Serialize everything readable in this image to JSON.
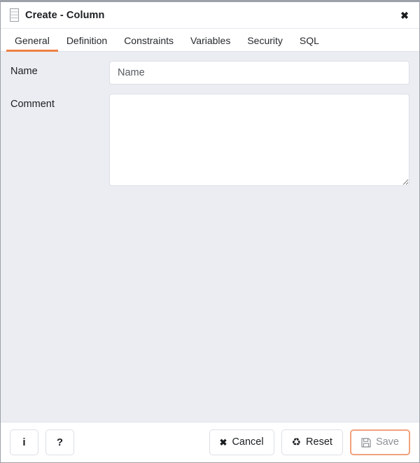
{
  "window": {
    "title": "Create - Column",
    "icon": "column-icon",
    "close_label": "✖"
  },
  "tabs": [
    {
      "label": "General",
      "active": true
    },
    {
      "label": "Definition",
      "active": false
    },
    {
      "label": "Constraints",
      "active": false
    },
    {
      "label": "Variables",
      "active": false
    },
    {
      "label": "Security",
      "active": false
    },
    {
      "label": "SQL",
      "active": false
    }
  ],
  "form": {
    "name": {
      "label": "Name",
      "value": "",
      "placeholder": "Name"
    },
    "comment": {
      "label": "Comment",
      "value": "",
      "placeholder": ""
    }
  },
  "footer": {
    "info_label": "i",
    "help_label": "?",
    "cancel": {
      "label": "Cancel",
      "icon": "✖"
    },
    "reset": {
      "label": "Reset",
      "icon": "♻"
    },
    "save": {
      "label": "Save",
      "icon": "save-floppy-icon",
      "disabled": true
    }
  },
  "colors": {
    "accent": "#ef8143",
    "save_border": "#f0a27c",
    "body_bg": "#ebedf2",
    "panel_bg": "#ffffff",
    "border": "#dcdfe6",
    "text": "#1b1e21"
  }
}
